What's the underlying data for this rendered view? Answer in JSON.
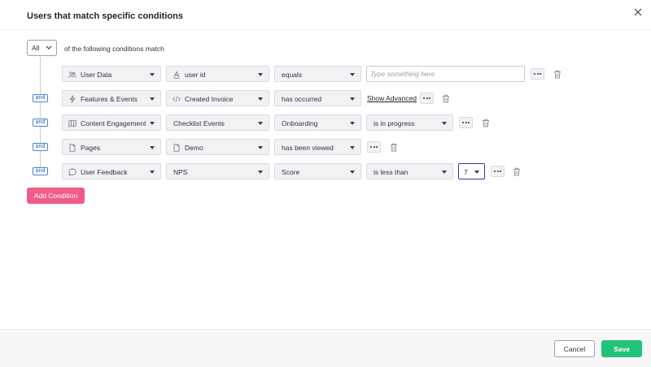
{
  "dialog": {
    "title": "Users that match specific conditions",
    "close_icon": "close-icon"
  },
  "match": {
    "mode": "All",
    "text": "of the following conditions match"
  },
  "rows": [
    {
      "connector": "",
      "category": {
        "label": "User Data",
        "icon": "users-icon"
      },
      "attribute": {
        "label": "user id",
        "icon": "text-icon"
      },
      "operator": {
        "label": "equals"
      },
      "value": {
        "placeholder": "Type something here",
        "value": ""
      }
    },
    {
      "connector": "and",
      "category": {
        "label": "Features & Events",
        "icon": "lightning-icon"
      },
      "attribute": {
        "label": "Created Invoice",
        "icon": "code-icon"
      },
      "operator": {
        "label": "has occurred"
      },
      "link": "Show Advanced"
    },
    {
      "connector": "and",
      "category": {
        "label": "Content Engagement",
        "icon": "map-icon"
      },
      "attribute": {
        "label": "Checklist Events"
      },
      "operator": {
        "label": "Onboarding"
      },
      "operator2": {
        "label": "is in progress"
      }
    },
    {
      "connector": "and",
      "category": {
        "label": "Pages",
        "icon": "document-icon"
      },
      "attribute": {
        "label": "Demo",
        "icon": "document-icon"
      },
      "operator": {
        "label": "has been viewed"
      }
    },
    {
      "connector": "and",
      "category": {
        "label": "User Feedback",
        "icon": "chat-bubble-icon"
      },
      "attribute": {
        "label": "NPS"
      },
      "operator": {
        "label": "Score"
      },
      "operator2": {
        "label": "is less than"
      },
      "number": {
        "label": "7"
      }
    }
  ],
  "add_condition_label": "Add Condition",
  "footer": {
    "cancel_label": "Cancel",
    "save_label": "Save"
  }
}
